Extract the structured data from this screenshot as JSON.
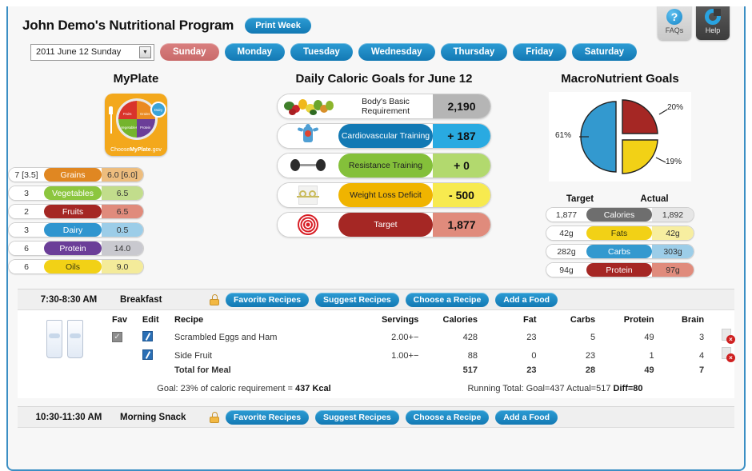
{
  "window": {
    "accent": "#3b8fc4"
  },
  "toptabs": [
    {
      "label": "FAQs",
      "icon": "question-circle-icon"
    },
    {
      "label": "Help",
      "icon": "help-ring-icon"
    }
  ],
  "header": {
    "title": "John Demo's Nutritional Program",
    "print_week_label": "Print Week"
  },
  "daybar": {
    "date_value": "2011 June 12 Sunday",
    "days": [
      "Sunday",
      "Monday",
      "Tuesday",
      "Wednesday",
      "Thursday",
      "Friday",
      "Saturday"
    ],
    "active_day": "Sunday"
  },
  "myplate": {
    "heading": "MyPlate",
    "logo": {
      "choose": "Choose",
      "brand": "MyPlate",
      "gov": ".gov",
      "quadrants": [
        "Fruits",
        "Grains",
        "Vegetables",
        "Protein"
      ],
      "dairy": "Dairy"
    },
    "rows": [
      {
        "left": "7 [3.5]",
        "label": "Grains",
        "right": "6.0 [6.0]",
        "color": "#e08722",
        "right_bg": "#edbd7e"
      },
      {
        "left": "3",
        "label": "Vegetables",
        "right": "6.5",
        "color": "#8cc63e",
        "right_bg": "#c2dd8c"
      },
      {
        "left": "2",
        "label": "Fruits",
        "right": "6.5",
        "color": "#a52724",
        "right_bg": "#e08b7c"
      },
      {
        "left": "3",
        "label": "Dairy",
        "right": "0.5",
        "color": "#2f95cf",
        "right_bg": "#9ccde8"
      },
      {
        "left": "6",
        "label": "Protein",
        "right": "14.0",
        "color": "#6b3e98",
        "right_bg": "#c9c9cf"
      },
      {
        "left": "6",
        "label": "Oils",
        "right": "9.0",
        "color": "#f2d116",
        "right_bg": "#f4eb9a"
      }
    ]
  },
  "caloric": {
    "heading": "Daily Caloric Goals for June 12",
    "rows": [
      {
        "icon": "vegetables-icon",
        "label": "Body's Basic Requirement",
        "value": "2,190",
        "bar": "#ffffff",
        "text_dark": true,
        "val_bg": "#b5b5b5"
      },
      {
        "icon": "cardio-body-icon",
        "label": "Cardiovascular Training",
        "value": "+ 187",
        "bar": "#1279b4",
        "text_dark": false,
        "val_bg": "#29aae1"
      },
      {
        "icon": "dumbbell-icon",
        "label": "Resistance Training",
        "value": "+ 0",
        "bar": "#84c03a",
        "text_dark": true,
        "val_bg": "#b2d96e"
      },
      {
        "icon": "weight-scale-icon",
        "label": "Weight Loss Deficit",
        "value": "- 500",
        "bar": "#f0b400",
        "text_dark": true,
        "val_bg": "#f7ea4f"
      },
      {
        "icon": "target-icon",
        "label": "Target",
        "value": "1,877",
        "bar": "#a52724",
        "text_dark": false,
        "val_bg": "#e08b7c"
      }
    ]
  },
  "macros": {
    "heading": "MacroNutrient Goals",
    "target_header": "Target",
    "actual_header": "Actual",
    "rows": [
      {
        "target": "1,877",
        "label": "Calories",
        "actual": "1,892",
        "color": "#6e6e6e",
        "right_bg": "#e6e6e6"
      },
      {
        "target": "42g",
        "label": "Fats",
        "actual": "42g",
        "color": "#f2d116",
        "right_bg": "#f7eea0"
      },
      {
        "target": "282g",
        "label": "Carbs",
        "actual": "303g",
        "color": "#3399cf",
        "right_bg": "#9ccde8"
      },
      {
        "target": "94g",
        "label": "Protein",
        "actual": "97g",
        "color": "#a52724",
        "right_bg": "#e08b7c"
      }
    ]
  },
  "chart_data": {
    "type": "pie",
    "title": "MacroNutrient Goals",
    "categories": [
      "Carbs",
      "Protein",
      "Fats"
    ],
    "values": [
      61,
      20,
      19
    ],
    "labels": [
      "61%",
      "20%",
      "19%"
    ],
    "colors": [
      "#3399cf",
      "#a52724",
      "#f2d116"
    ],
    "exploded": true,
    "legend": "none"
  },
  "meals": [
    {
      "time": "7:30-8:30 AM",
      "name": "Breakfast",
      "lock_icon": "lock-icon",
      "actions": [
        "Favorite Recipes",
        "Suggest Recipes",
        "Choose a Recipe",
        "Add a Food"
      ],
      "expanded": true,
      "columns": [
        "Fav",
        "Edit",
        "Recipe",
        "Servings",
        "Calories",
        "Fat",
        "Carbs",
        "Protein",
        "Brain"
      ],
      "items": [
        {
          "fav": true,
          "recipe": "Scrambled Eggs and Ham",
          "servings": "2.00",
          "calories": "428",
          "fat": "23",
          "carbs": "5",
          "protein": "49",
          "brain": "3"
        },
        {
          "fav": false,
          "recipe": "Side Fruit",
          "servings": "1.00",
          "calories": "88",
          "fat": "0",
          "carbs": "23",
          "protein": "1",
          "brain": "4"
        }
      ],
      "total": {
        "recipe": "Total for Meal",
        "calories": "517",
        "fat": "23",
        "carbs": "28",
        "protein": "49",
        "brain": "7"
      },
      "goal_text": "Goal: 23% of caloric requirement = ",
      "goal_value": "437 Kcal",
      "running_text": "Running Total: Goal=437 Actual=517 ",
      "running_value": "Diff=80",
      "stepper_plus": "+",
      "stepper_minus": "−"
    },
    {
      "time": "10:30-11:30 AM",
      "name": "Morning Snack",
      "lock_icon": "lock-icon",
      "actions": [
        "Favorite Recipes",
        "Suggest Recipes",
        "Choose a Recipe",
        "Add a Food"
      ],
      "expanded": false
    }
  ]
}
